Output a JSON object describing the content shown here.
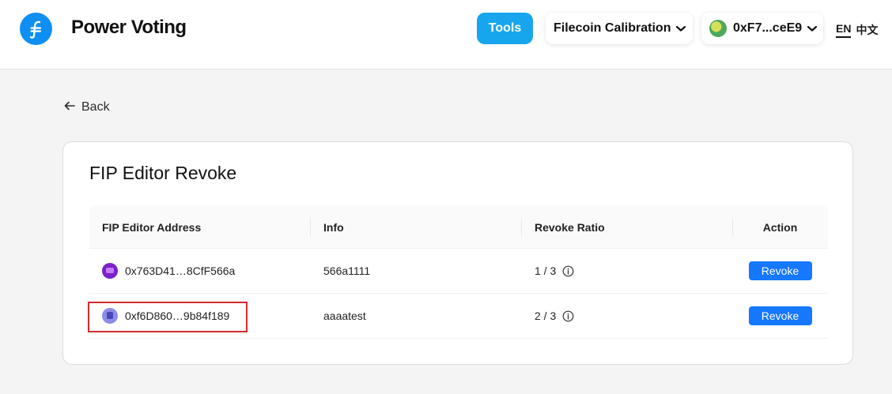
{
  "header": {
    "app_title": "Power Voting",
    "tools_label": "Tools",
    "network_label": "Filecoin Calibration",
    "wallet_label": "0xF7...ceE9",
    "lang_en": "EN",
    "lang_zh": "中文",
    "logo_icon": "filecoin-logo-icon",
    "brand_color": "#0f8ff2",
    "tools_color": "#17a6ee"
  },
  "nav": {
    "back_label": "Back"
  },
  "card": {
    "title": "FIP Editor Revoke",
    "columns": [
      "FIP Editor Address",
      "Info",
      "Revoke Ratio",
      "Action"
    ],
    "rows": [
      {
        "address": "0x763D41…8CfF566a",
        "info": "566a1111",
        "ratio": "1 / 3",
        "action": "Revoke"
      },
      {
        "address": "0xf6D860…9b84f189",
        "info": "aaaatest",
        "ratio": "2 / 3",
        "action": "Revoke"
      }
    ],
    "action_color": "#1677ff"
  },
  "highlight_color": "#d32a2a"
}
